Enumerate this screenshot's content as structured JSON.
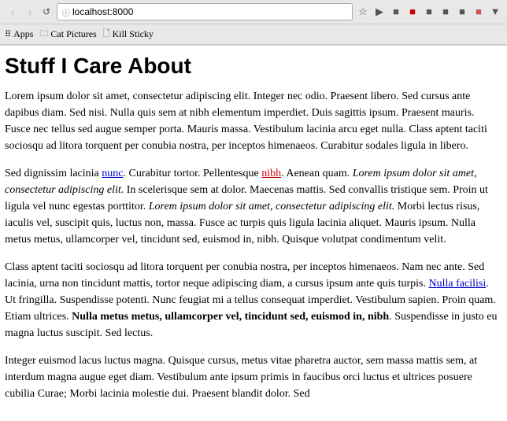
{
  "browser": {
    "back_button": "‹",
    "forward_button": "›",
    "reload_button": "↺",
    "address": "localhost:8000",
    "star_icon": "☆",
    "lock_icon": "ⓘ"
  },
  "bookmarks": {
    "apps_icon": "⠿",
    "apps_label": "Apps",
    "cat_pictures_icon": "📁",
    "cat_pictures_label": "Cat Pictures",
    "kill_sticky_icon": "📄",
    "kill_sticky_label": "Kill Sticky"
  },
  "page": {
    "title": "Stuff I Care About",
    "paragraph1": "Lorem ipsum dolor sit amet, consectetur adipiscing elit. Integer nec odio. Praesent libero. Sed cursus ante dapibus diam. Sed nisi. Nulla quis sem at nibh elementum imperdiet. Duis sagittis ipsum. Praesent mauris. Fusce nec tellus sed augue semper porta. Mauris massa. Vestibulum lacinia arcu eget nulla. Class aptent taciti sociosqu ad litora torquent per conubia nostra, per inceptos himenaeos. Curabitur sodales ligula in libero.",
    "paragraph2_part1": "Sed dignissim lacinia ",
    "paragraph2_link1": "nunc",
    "paragraph2_part2": ". Curabitur tortor. Pellentesque ",
    "paragraph2_link2": "nibh",
    "paragraph2_part3": ". Aenean quam. ",
    "paragraph2_italic1": "Lorem ipsum dolor sit amet, consectetur adipiscing elit.",
    "paragraph2_part4": " In scelerisque sem at dolor. Maecenas mattis. Sed convallis tristique sem. Proin ut ligula vel nunc egestas porttitor. ",
    "paragraph2_italic2": "Lorem ipsum dolor sit amet, consectetur adipiscing elit.",
    "paragraph2_part5": " Morbi lectus risus, iaculis vel, suscipit quis, luctus non, massa. Fusce ac turpis quis ligula lacinia aliquet. Mauris ipsum. Nulla metus metus, ullamcorper vel, tincidunt sed, euismod in, nibh. Quisque volutpat condimentum velit.",
    "paragraph3_part1": "Class aptent taciti sociosqu ad litora torquent per conubia nostra, per inceptos himenaeos. Nam nec ante. Sed lacinia, urna non tincidunt mattis, tortor neque adipiscing diam, a cursus ipsum ante quis turpis. ",
    "paragraph3_link1": "Nulla facilisi",
    "paragraph3_part2": ". Ut fringilla. Suspendisse potenti. Nunc feugiat mi a tellus consequat imperdiet. Vestibulum sapien. Proin quam. Etiam ultrices. ",
    "paragraph3_bold1": "Nulla metus metus, ullamcorper vel, tincidunt sed, euismod in, nibh",
    "paragraph3_part3": ". Suspendisse in justo eu magna luctus suscipit. Sed lectus.",
    "paragraph4": "Integer euismod lacus luctus magna. Quisque cursus, metus vitae pharetra auctor, sem massa mattis sem, at interdum magna augue eget diam. Vestibulum ante ipsum primis in faucibus orci luctus et ultrices posuere cubilia Curae; Morbi lacinia molestie dui. Praesent blandit dolor. Sed"
  }
}
